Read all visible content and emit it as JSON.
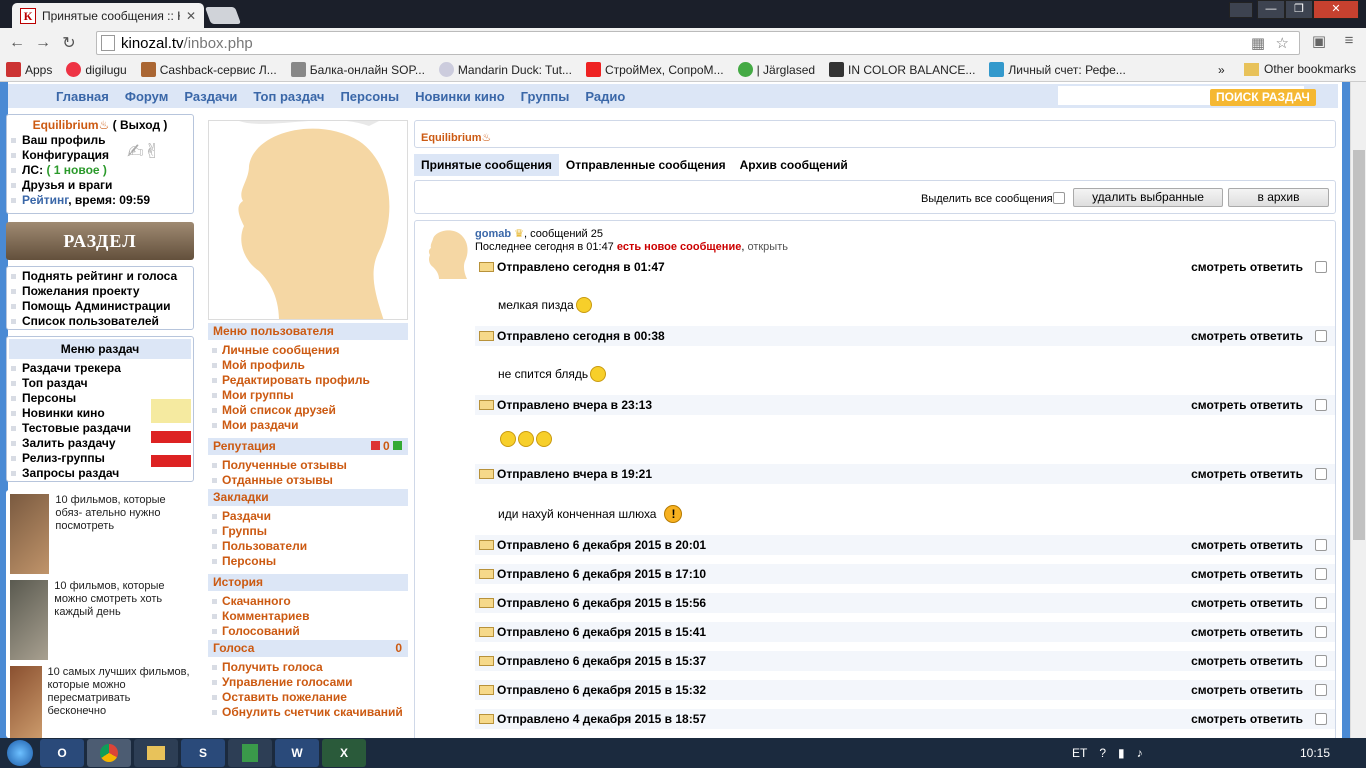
{
  "browser": {
    "tab_title": "Принятые сообщения :: К",
    "tab_icon": "К",
    "url_host": "kinozal.tv",
    "url_path": "/inbox.php",
    "bookmarks": [
      {
        "label": "Apps",
        "color": "#c33"
      },
      {
        "label": "digilugu",
        "color": "#e34"
      },
      {
        "label": "Cashback-сервис Л...",
        "color": "#a63"
      },
      {
        "label": "Балка-онлайн SOP...",
        "color": "#888"
      },
      {
        "label": "Mandarin Duck: Tut...",
        "color": "#ccd"
      },
      {
        "label": "СтройМех, СопроМ...",
        "color": "#e22"
      },
      {
        "label": "| Järglased",
        "color": "#4a4"
      },
      {
        "label": "IN COLOR BALANCE...",
        "color": "#333"
      },
      {
        "label": "Личный счет: Рефе...",
        "color": "#39c"
      }
    ],
    "bookmarks_overflow": "»",
    "other_bookmarks": "Other bookmarks"
  },
  "topnav": [
    "Главная",
    "Форум",
    "Раздачи",
    "Топ раздач",
    "Персоны",
    "Новинки кино",
    "Группы",
    "Радио"
  ],
  "search_button": "ПОИСК РАЗДАЧ",
  "userbox": {
    "username": "Equilibrium",
    "logout": "( Выход )",
    "profile": "Ваш профиль",
    "config": "Конфигурация",
    "pm_label": "ЛС:",
    "pm_new": "( 1 новое )",
    "friends": "Друзья и враги",
    "rating": "Рейтинг",
    "time": ", время: 09:59"
  },
  "mecenat": "РАЗДЕЛ МЕЦЕНАТОВ",
  "links_box": [
    "Поднять рейтинг и голоса",
    "Пожелания проекту",
    "Помощь Администрации",
    "Список пользователей"
  ],
  "menu_razdach": {
    "title": "Меню раздач",
    "items": [
      "Раздачи трекера",
      "Топ раздач",
      "Персоны",
      "Новинки кино",
      "Тестовые раздачи",
      "Залить раздачу",
      "Релиз-группы",
      "Запросы раздач"
    ]
  },
  "promos": [
    {
      "text": "10 фильмов, которые обяз- ательно нужно посмотреть"
    },
    {
      "text": "10 фильмов, которые можно смотреть хоть каждый день"
    },
    {
      "text": "10 самых лучших фильмов, которые можно пересматривать бесконечно"
    }
  ],
  "user_menu": {
    "title": "Меню пользователя",
    "items": [
      "Личные сообщения",
      "Мой профиль",
      "Редактировать профиль",
      "Мои группы",
      "Мой список друзей",
      "Мои раздачи"
    ]
  },
  "reputation": {
    "title": "Репутация",
    "value": "0",
    "items": [
      "Полученные отзывы",
      "Отданные отзывы"
    ]
  },
  "bookmarks_menu": {
    "title": "Закладки",
    "items": [
      "Раздачи",
      "Группы",
      "Пользователи",
      "Персоны"
    ]
  },
  "history": {
    "title": "История",
    "items": [
      "Скачанного",
      "Комментариев",
      "Голосований"
    ]
  },
  "votes": {
    "title": "Голоса",
    "value": "0",
    "items": [
      "Получить голоса",
      "Управление голосами",
      "Оставить пожелание",
      "Обнулить счетчик скачиваний"
    ]
  },
  "main": {
    "owner": "Equilibrium",
    "tabs": [
      "Принятые сообщения",
      "Отправленные сообщения",
      "Архив сообщений"
    ],
    "select_all": "Выделить все сообщения",
    "delete_btn": "удалить выбранные",
    "archive_btn": "в архив",
    "sender": "gomab",
    "sender_count": ", сообщений 25",
    "last_line_a": "Последнее сегодня в 01:47",
    "last_line_new": "есть новое сообщение",
    "last_line_comma": ",",
    "last_line_open": "открыть",
    "view": "смотреть",
    "reply": "ответить",
    "messages": [
      {
        "header": "Отправлено сегодня в 01:47",
        "body": "мелкая пизда"
      },
      {
        "header": "Отправлено сегодня в 00:38",
        "body": "не спится блядь"
      },
      {
        "header": "Отправлено вчера в 23:13",
        "body": ""
      },
      {
        "header": "Отправлено вчера в 19:21",
        "body": "иди нахуй конченная шлюха"
      },
      {
        "header": "Отправлено 6 декабря 2015 в 20:01",
        "body": ""
      },
      {
        "header": "Отправлено 6 декабря 2015 в 17:10",
        "body": ""
      },
      {
        "header": "Отправлено 6 декабря 2015 в 15:56",
        "body": ""
      },
      {
        "header": "Отправлено 6 декабря 2015 в 15:41",
        "body": ""
      },
      {
        "header": "Отправлено 6 декабря 2015 в 15:37",
        "body": ""
      },
      {
        "header": "Отправлено 6 декабря 2015 в 15:32",
        "body": ""
      },
      {
        "header": "Отправлено 4 декабря 2015 в 18:57",
        "body": ""
      }
    ]
  },
  "taskbar": {
    "apps": [
      "O",
      "",
      "",
      "S",
      "",
      "W",
      "X"
    ],
    "lang": "ET",
    "time": "10:15"
  }
}
